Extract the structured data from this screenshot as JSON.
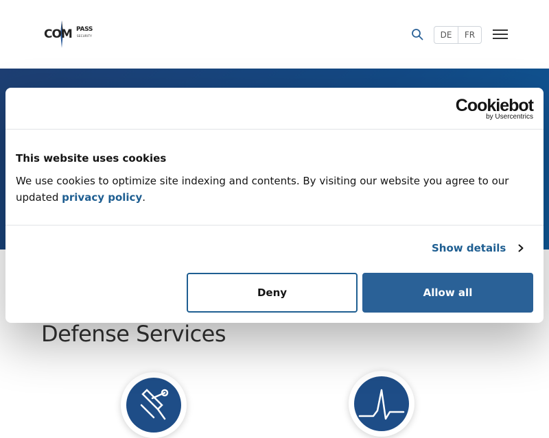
{
  "header": {
    "logo_text": "COMPASS",
    "logo_main": "COM",
    "logo_pass": "PASS",
    "logo_sub": "SECURITY",
    "search_icon": "search-icon",
    "languages": [
      "DE",
      "FR"
    ],
    "menu_icon": "hamburger-menu-icon"
  },
  "main": {
    "section_title": "Defense Services",
    "service_icons": [
      "rocket-icon",
      "heartbeat-pulse-icon"
    ]
  },
  "cookie_banner": {
    "brand": "Cookiebot",
    "brand_by": "by Usercentrics",
    "title": "This website uses cookies",
    "text_before_link": "We use cookies to optimize site indexing and contents. By visiting our website you agree to our updated ",
    "link_text": "privacy policy",
    "text_after_link": ".",
    "show_details_label": "Show details",
    "deny_label": "Deny",
    "allow_label": "Allow all"
  },
  "colors": {
    "accent": "#1e5e91",
    "hero": "#134a86",
    "allow_button": "#2a6197"
  }
}
